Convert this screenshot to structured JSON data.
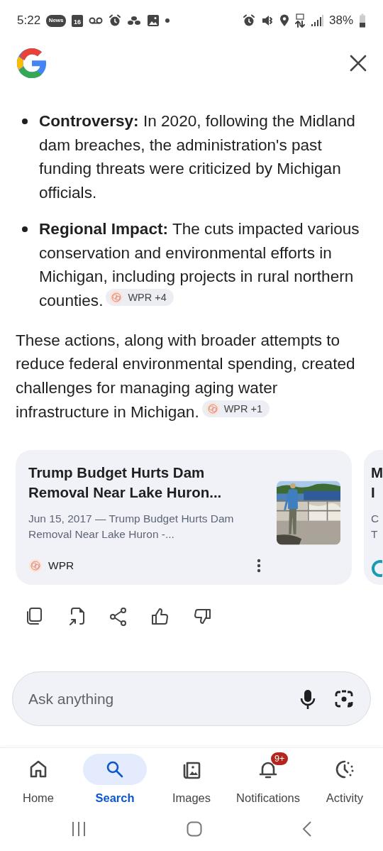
{
  "status_bar": {
    "time": "5:22",
    "news_label": "News",
    "calendar_day": "16",
    "battery": "38%"
  },
  "answer": {
    "bullets": [
      {
        "text": "**Controversy:** In 2020, following the Midland dam breaches, the administration's past funding threats were criticized by Michigan officials."
      },
      {
        "text": "**Regional Impact:** The cuts impacted various conservation and environmental efforts in Michigan, including projects in rural northern counties.",
        "citation": "WPR +4"
      }
    ],
    "paragraph": {
      "text": "These actions, along with broader attempts to reduce federal environmental spending, created challenges for managing aging water infrastructure in Michigan.",
      "citation": "WPR +1"
    }
  },
  "cards": [
    {
      "kind": "full",
      "title": "Trump Budget Hurts Dam Removal Near Lake Huron...",
      "snippet": "Jun 15, 2017 — Trump Budget Hurts Dam Removal Near Lake Huron -...",
      "source": "WPR"
    },
    {
      "kind": "peek",
      "title_lines": [
        "M",
        "I"
      ],
      "snippet_lines": [
        "C",
        "T"
      ]
    }
  ],
  "search": {
    "placeholder": "Ask anything"
  },
  "nav": [
    {
      "label": "Home",
      "selected": false
    },
    {
      "label": "Search",
      "selected": true
    },
    {
      "label": "Images",
      "selected": false
    },
    {
      "label": "Notifications",
      "selected": false,
      "badge": "9+"
    },
    {
      "label": "Activity",
      "selected": false
    }
  ]
}
